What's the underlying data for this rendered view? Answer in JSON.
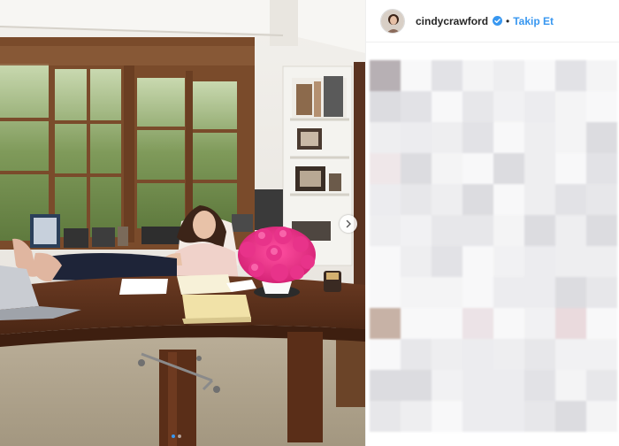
{
  "post": {
    "username": "cindycrawford",
    "separator": "•",
    "follow_label": "Takip Et",
    "verified": true,
    "accent_color": "#3897f0"
  },
  "carousel": {
    "total_slides": 2,
    "active_slide": 1
  },
  "comments": {
    "obscured": true
  },
  "icons": {
    "verified": "verified-badge-icon",
    "next": "chevron-right-icon"
  }
}
